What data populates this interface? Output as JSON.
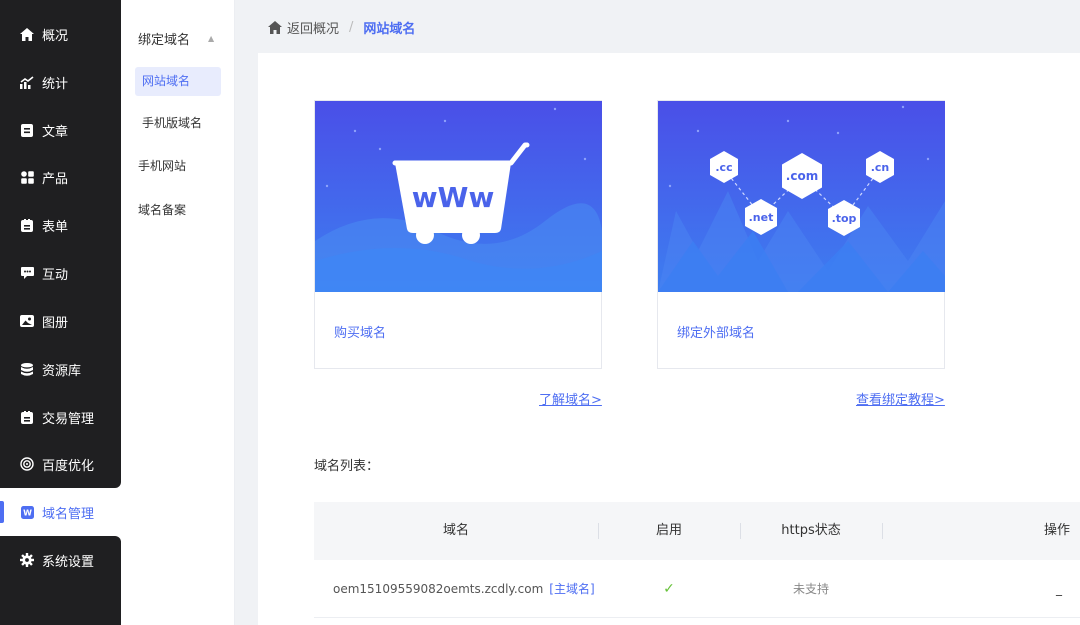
{
  "sidebar": {
    "items": [
      {
        "label": "概况",
        "icon": "home-icon"
      },
      {
        "label": "统计",
        "icon": "chart-icon"
      },
      {
        "label": "文章",
        "icon": "article-icon"
      },
      {
        "label": "产品",
        "icon": "grid-icon"
      },
      {
        "label": "表单",
        "icon": "form-icon"
      },
      {
        "label": "互动",
        "icon": "chat-icon"
      },
      {
        "label": "图册",
        "icon": "album-icon"
      },
      {
        "label": "资源库",
        "icon": "database-icon"
      },
      {
        "label": "交易管理",
        "icon": "trade-icon"
      },
      {
        "label": "百度优化",
        "icon": "target-icon"
      },
      {
        "label": "域名管理",
        "icon": "domain-icon",
        "badge": "W"
      },
      {
        "label": "系统设置",
        "icon": "gear-icon"
      }
    ]
  },
  "subnav": {
    "header": "绑定域名",
    "items": [
      "网站域名",
      "手机版域名",
      "手机网站",
      "域名备案"
    ]
  },
  "breadcrumb": {
    "back": "返回概况",
    "separator": "/",
    "current": "网站域名"
  },
  "cards": {
    "buy": {
      "label": "购买域名",
      "link": "了解域名>",
      "banner_text": "wWw"
    },
    "bind": {
      "label": "绑定外部域名",
      "link": "查看绑定教程>",
      "tlds": [
        ".cc",
        ".com",
        ".cn",
        ".net",
        ".top"
      ]
    }
  },
  "list": {
    "title": "域名列表：",
    "columns": [
      "域名",
      "启用",
      "https状态",
      "操作"
    ],
    "rows": [
      {
        "domain": "oem15109559082oemts.zcdly.com",
        "tag": "[主域名]",
        "enabled": "✓",
        "https": "未支持",
        "action": "_"
      }
    ]
  },
  "colors": {
    "accent": "#4e6ef2",
    "sidebar_bg": "#1f1f21",
    "check": "#67c23a"
  }
}
